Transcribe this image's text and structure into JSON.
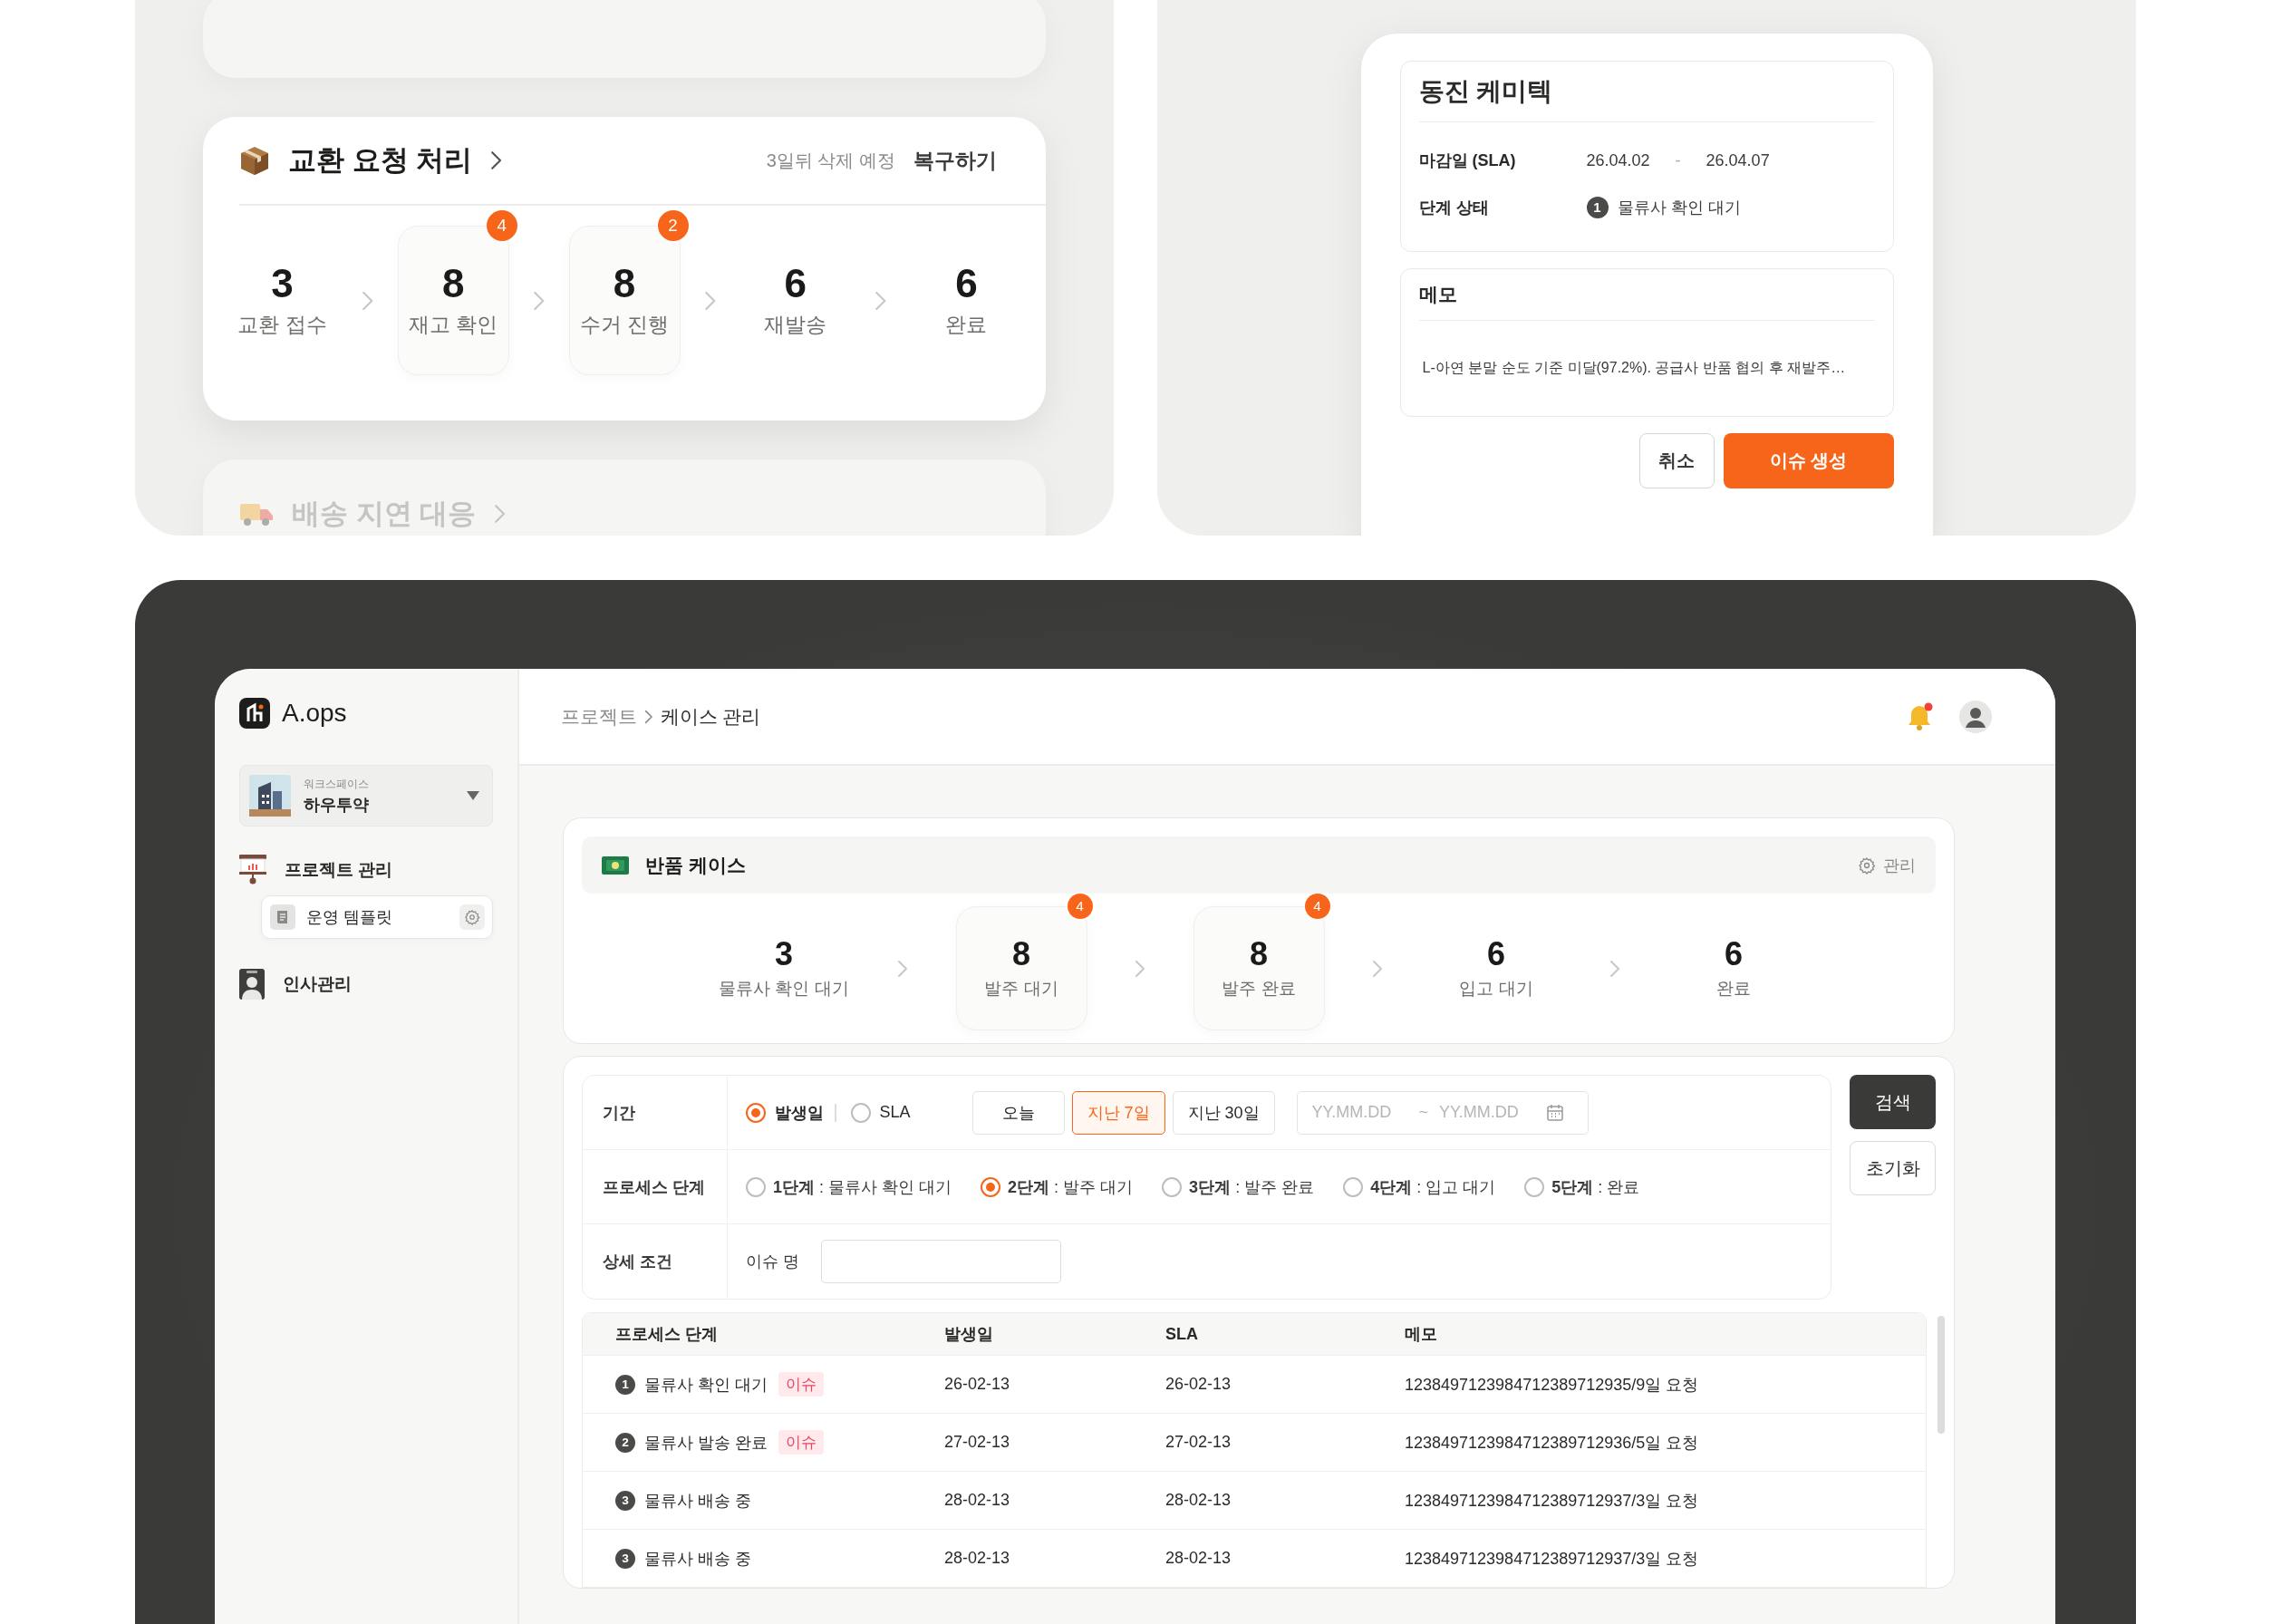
{
  "exchange_panel": {
    "title": "교환 요청 처리",
    "deletion_note": "3일뒤 삭제 예정",
    "restore_link": "복구하기",
    "steps": [
      {
        "count": "3",
        "label": "교환 접수",
        "highlighted": false
      },
      {
        "count": "8",
        "label": "재고 확인",
        "highlighted": true,
        "badge": "4"
      },
      {
        "count": "8",
        "label": "수거 진행",
        "highlighted": true,
        "badge": "2"
      },
      {
        "count": "6",
        "label": "재발송",
        "highlighted": false
      },
      {
        "count": "6",
        "label": "완료",
        "highlighted": false
      }
    ],
    "next_card": {
      "title": "배송 지연 대응"
    }
  },
  "issue_dialog": {
    "company": "동진 케미텍",
    "sla_label": "마감일 (SLA)",
    "sla_start": "26.04.02",
    "sla_separator": "-",
    "sla_end": "26.04.07",
    "stage_label": "단계 상태",
    "stage_number": "1",
    "stage_value": "물류사 확인 대기",
    "memo_title": "메모",
    "memo_text": "L-아연 분말 순도 기준 미달(97.2%). 공급사 반품 협의 후 재발주…",
    "buttons": [
      {
        "label": "취소",
        "kind": "secondary"
      },
      {
        "label": "이슈 생성",
        "kind": "primary"
      }
    ]
  },
  "app": {
    "logo": "A.ops",
    "workspace": {
      "caption": "워크스페이스",
      "name": "하우투약"
    },
    "nav": [
      {
        "label": "프로젝트 관리",
        "children": [
          {
            "label": "운영 템플릿",
            "selected": true
          }
        ]
      },
      {
        "label": "인사관리"
      }
    ],
    "breadcrumb": [
      "프로젝트",
      "케이스 관리"
    ],
    "has_notification": true,
    "case_card": {
      "title": "반품 케이스",
      "manage": "관리",
      "steps": [
        {
          "count": "3",
          "label": "물류사 확인 대기",
          "highlighted": false
        },
        {
          "count": "8",
          "label": "발주 대기",
          "highlighted": true,
          "badge": "4"
        },
        {
          "count": "8",
          "label": "발주 완료",
          "highlighted": true,
          "badge": "4"
        },
        {
          "count": "6",
          "label": "입고 대기",
          "highlighted": false
        },
        {
          "count": "6",
          "label": "완료",
          "highlighted": false
        }
      ]
    },
    "filters": {
      "period_label": "기간",
      "date_basis": [
        {
          "label": "발생일",
          "selected": true
        },
        {
          "label": "SLA",
          "selected": false
        }
      ],
      "quick_ranges": [
        {
          "label": "오늘",
          "selected": false
        },
        {
          "label": "지난 7일",
          "selected": true
        },
        {
          "label": "지난 30일",
          "selected": false
        }
      ],
      "date_start_placeholder": "YY.MM.DD",
      "date_separator": "~",
      "date_end_placeholder": "YY.MM.DD",
      "process_label": "프로세스 단계",
      "process_options": [
        {
          "step": "1단계",
          "desc": ": 물류사 확인 대기",
          "selected": false
        },
        {
          "step": "2단계",
          "desc": ": 발주 대기",
          "selected": true
        },
        {
          "step": "3단계",
          "desc": ": 발주 완료",
          "selected": false
        },
        {
          "step": "4단계",
          "desc": ": 입고 대기",
          "selected": false
        },
        {
          "step": "5단계",
          "desc": ": 완료",
          "selected": false
        }
      ],
      "detail_label": "상세 조건",
      "issue_name_label": "이슈 명",
      "search_button": "검색",
      "reset_button": "초기화"
    },
    "table": {
      "columns": [
        "프로세스 단계",
        "발생일",
        "SLA",
        "메모"
      ],
      "rows": [
        {
          "number": "1",
          "stage": "물류사 확인 대기",
          "tag": "이슈",
          "date": "26-02-13",
          "sla": "26-02-13",
          "memo": "1238497123984712389712935/9일 요청"
        },
        {
          "number": "2",
          "stage": "물류사 발송 완료",
          "tag": "이슈",
          "date": "27-02-13",
          "sla": "27-02-13",
          "memo": "1238497123984712389712936/5일 요청"
        },
        {
          "number": "3",
          "stage": "물류사 배송 중",
          "date": "28-02-13",
          "sla": "28-02-13",
          "memo": "1238497123984712389712937/3일 요청"
        },
        {
          "number": "3",
          "stage": "물류사 배송 중",
          "date": "28-02-13",
          "sla": "28-02-13",
          "memo": "1238497123984712389712937/3일 요청"
        }
      ]
    }
  }
}
